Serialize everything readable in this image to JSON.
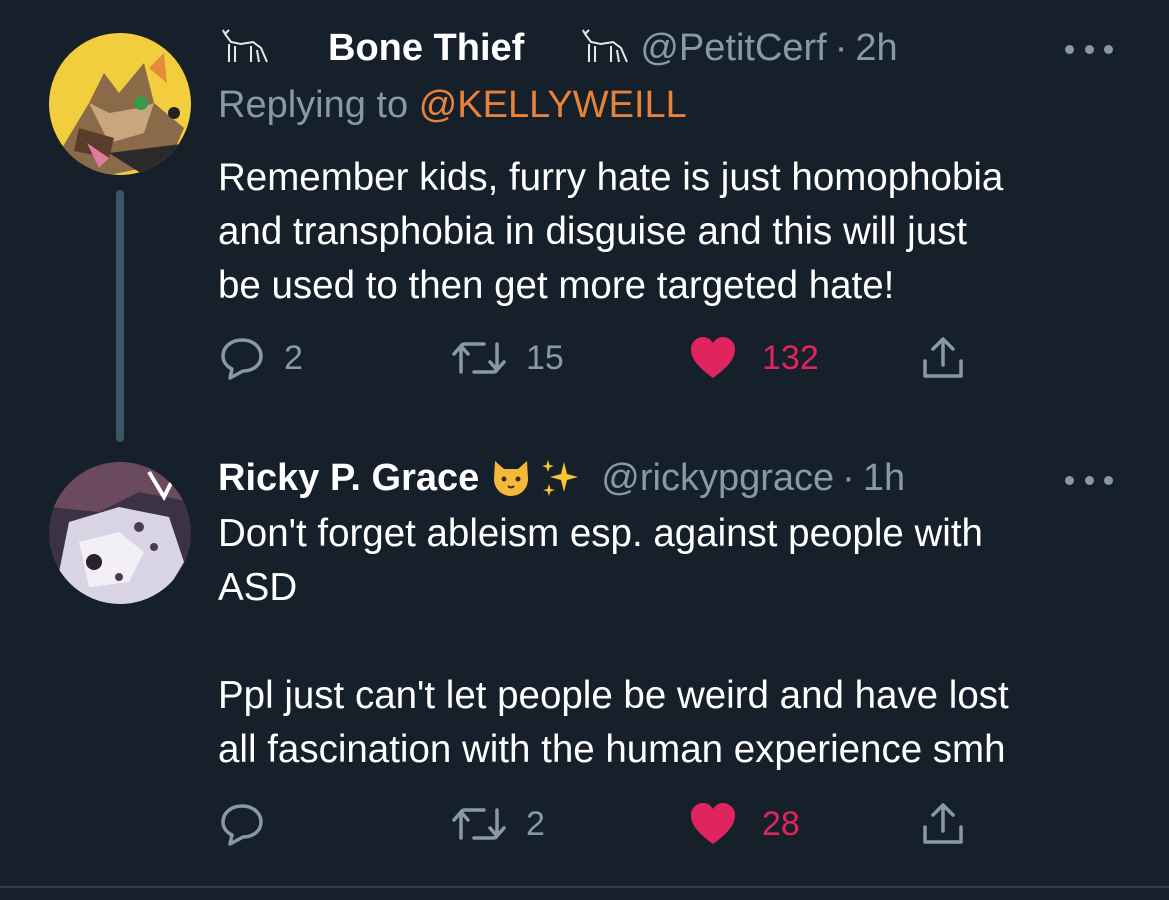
{
  "tweets": [
    {
      "display_name": "Bone Thief",
      "handle": "@PetitCerf",
      "separator": "·",
      "time": "2h",
      "replying_prefix": "Replying to",
      "replying_to": "@KELLYWEILL",
      "text": "Remember kids, furry hate is just homophobia\nand transphobia in disguise and this will just\nbe used to then get more targeted hate!",
      "reply_count": "2",
      "retweet_count": "15",
      "like_count": "132",
      "liked": true
    },
    {
      "display_name": "Ricky P. Grace",
      "handle": "@rickypgrace",
      "separator": "·",
      "time": "1h",
      "text": "Don't forget ableism esp. against people with\nASD\n\nPpl just can't let people be weird and have lost\nall fascination with the human experience smh",
      "reply_count": "",
      "retweet_count": "2",
      "like_count": "28",
      "liked": true
    }
  ],
  "colors": {
    "background": "#15202b",
    "secondary_text": "#8899a6",
    "mention": "#e8823a",
    "like": "#e0245e"
  },
  "icons": [
    "fox-icon",
    "crescent-moon-icon",
    "cat-face-icon",
    "sparkles-icon",
    "reply-icon",
    "retweet-icon",
    "heart-icon",
    "share-icon",
    "more-icon"
  ]
}
